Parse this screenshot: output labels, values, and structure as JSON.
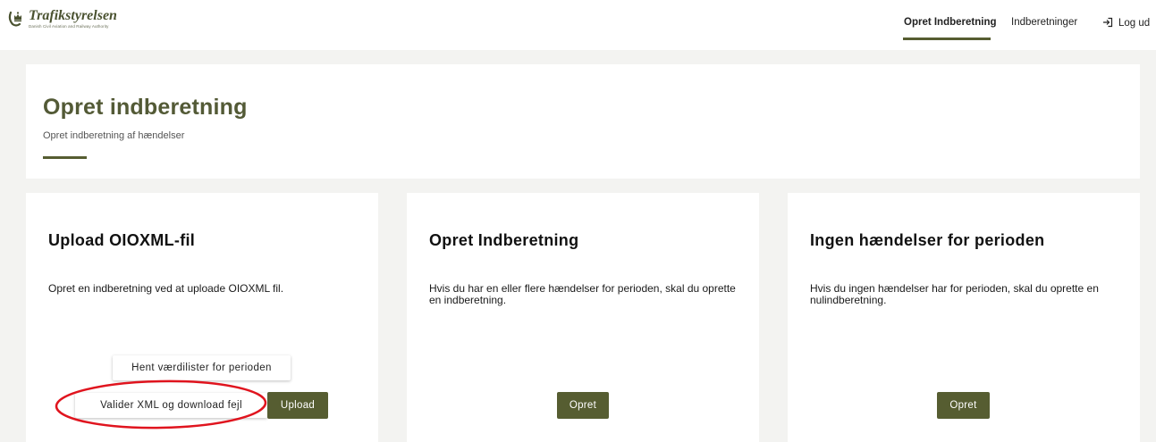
{
  "header": {
    "logo_name": "Trafikstyrelsen",
    "logo_tagline": "Danish Civil Aviation and Railway Authority",
    "nav": {
      "create": "Opret Indberetning",
      "reports": "Indberetninger",
      "logout": "Log ud"
    }
  },
  "hero": {
    "title": "Opret indberetning",
    "subtitle": "Opret indberetning af hændelser"
  },
  "cards": [
    {
      "title": "Upload OIOXML-fil",
      "text": "Opret en indberetning ved at uploade OIOXML fil.",
      "fetch_label": "Hent værdilister for perioden",
      "validate_label": "Valider XML og download fejl",
      "upload_label": "Upload"
    },
    {
      "title": "Opret Indberetning",
      "text": "Hvis du har en eller flere hændelser for perioden, skal du oprette en indberetning.",
      "button_label": "Opret"
    },
    {
      "title": "Ingen hændelser for perioden",
      "text": "Hvis du ingen hændelser har for perioden, skal du oprette en nulindberetning.",
      "button_label": "Opret"
    }
  ],
  "colors": {
    "accent": "#565d31",
    "annotation": "#e0141e"
  },
  "icons": {
    "logo": "crown-icon",
    "logout": "logout-icon"
  }
}
